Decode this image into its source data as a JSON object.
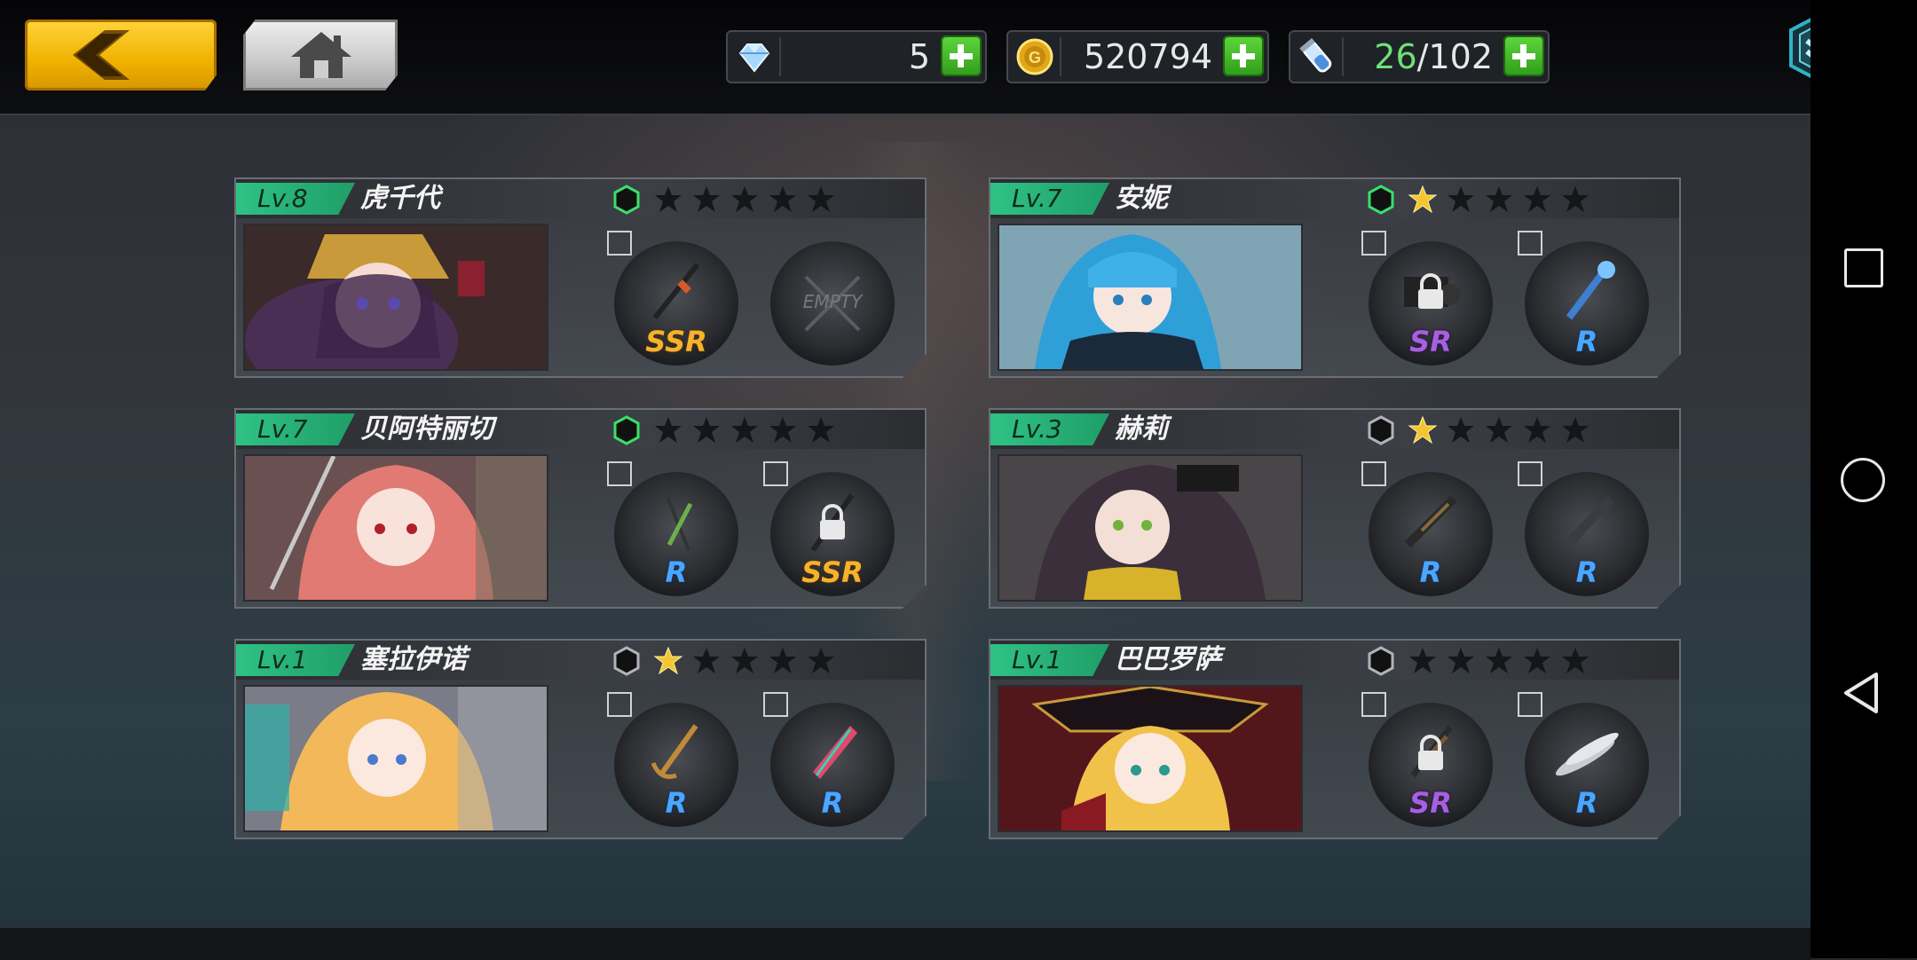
{
  "resources": {
    "diamonds": "5",
    "gold": "520794",
    "stamina_current": "26",
    "stamina_max": "/102"
  },
  "colors": {
    "accent_yellow": "#f0b100",
    "level_green": "#2fc285",
    "rarity_r": "#4aa6ff",
    "rarity_ssr": "#f7b22c",
    "rarity_sr": "#a760e0",
    "star_gold": "#f4c531"
  },
  "cards": [
    {
      "level": "Lv.8",
      "name": "虎千代",
      "hex_active": true,
      "stars": 0,
      "slots": [
        {
          "rarity": "SSR",
          "locked": false,
          "empty": false
        },
        {
          "rarity": "",
          "empty_text": "EMPTY",
          "locked": false,
          "empty": true
        }
      ]
    },
    {
      "level": "Lv.7",
      "name": "安妮",
      "hex_active": true,
      "stars": 1,
      "slots": [
        {
          "rarity": "SR",
          "locked": true,
          "empty": false
        },
        {
          "rarity": "R",
          "locked": false,
          "empty": false
        }
      ]
    },
    {
      "level": "Lv.7",
      "name": "贝阿特丽切",
      "hex_active": true,
      "stars": 0,
      "slots": [
        {
          "rarity": "R",
          "locked": false,
          "empty": false
        },
        {
          "rarity": "SSR",
          "locked": true,
          "empty": false
        }
      ]
    },
    {
      "level": "Lv.3",
      "name": "赫莉",
      "hex_active": false,
      "stars": 1,
      "slots": [
        {
          "rarity": "R",
          "locked": false,
          "empty": false
        },
        {
          "rarity": "R",
          "locked": false,
          "empty": false
        }
      ]
    },
    {
      "level": "Lv.1",
      "name": "塞拉伊诺",
      "hex_active": false,
      "stars": 1,
      "slots": [
        {
          "rarity": "R",
          "locked": false,
          "empty": false
        },
        {
          "rarity": "R",
          "locked": false,
          "empty": false
        }
      ]
    },
    {
      "level": "Lv.1",
      "name": "巴巴罗萨",
      "hex_active": false,
      "stars": 0,
      "slots": [
        {
          "rarity": "SR",
          "locked": true,
          "empty": false
        },
        {
          "rarity": "R",
          "locked": false,
          "empty": false
        }
      ]
    }
  ]
}
